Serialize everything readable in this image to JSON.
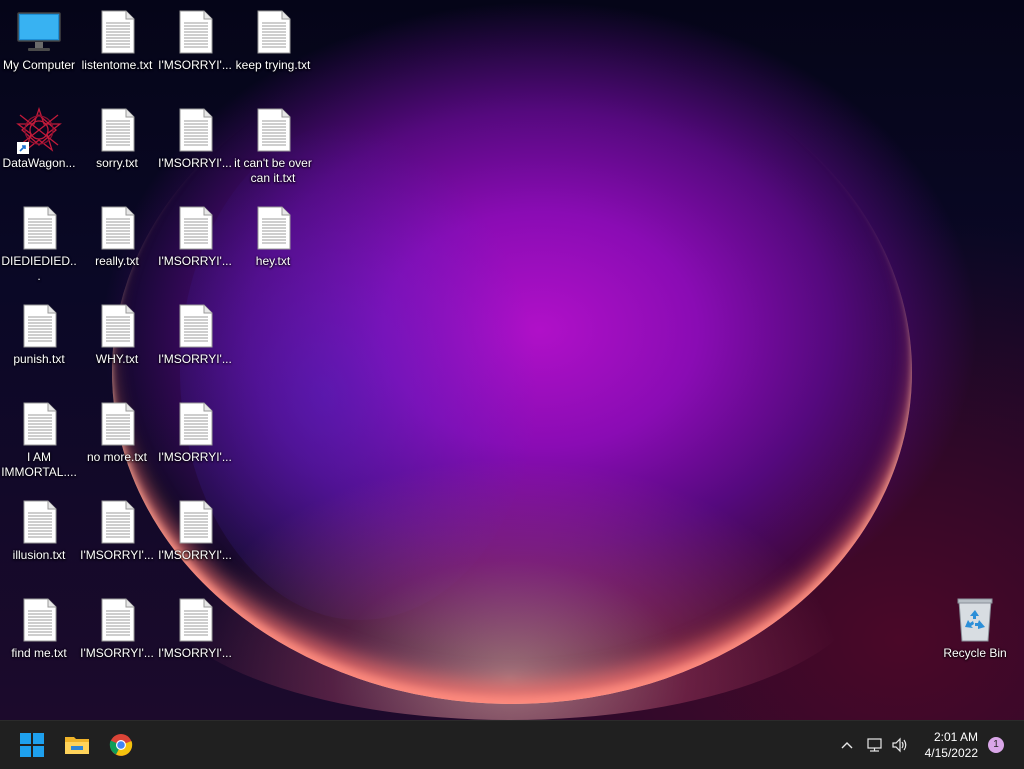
{
  "desktop": {
    "icons": [
      {
        "label": "My Computer"
      },
      {
        "label": "listentome.txt"
      },
      {
        "label": "I'MSORRYI'..."
      },
      {
        "label": "keep trying.txt"
      },
      {
        "label": "DataWagon..."
      },
      {
        "label": "sorry.txt"
      },
      {
        "label": "I'MSORRYI'..."
      },
      {
        "label": "it can't be over can it.txt"
      },
      {
        "label": "DIEDIEDIED..."
      },
      {
        "label": "really.txt"
      },
      {
        "label": "I'MSORRYI'..."
      },
      {
        "label": "hey.txt"
      },
      {
        "label": "punish.txt"
      },
      {
        "label": "WHY.txt"
      },
      {
        "label": "I'MSORRYI'..."
      },
      {
        "label": "I AM IMMORTAL...."
      },
      {
        "label": "no more.txt"
      },
      {
        "label": "I'MSORRYI'..."
      },
      {
        "label": "illusion.txt"
      },
      {
        "label": "I'MSORRYI'..."
      },
      {
        "label": "I'MSORRYI'..."
      },
      {
        "label": "find me.txt"
      },
      {
        "label": "I'MSORRYI'..."
      },
      {
        "label": "I'MSORRYI'..."
      },
      {
        "label": "Recycle Bin"
      }
    ]
  },
  "taskbar": {
    "pinned": [
      "start-button",
      "file-explorer",
      "chrome"
    ],
    "clock_time": "2:01 AM",
    "clock_date": "4/15/2022",
    "notification_count": "1"
  },
  "colors": {
    "taskbar": "#202020",
    "accent_start": "#1ea0ee",
    "notification_badge": "#d9a6e8"
  }
}
